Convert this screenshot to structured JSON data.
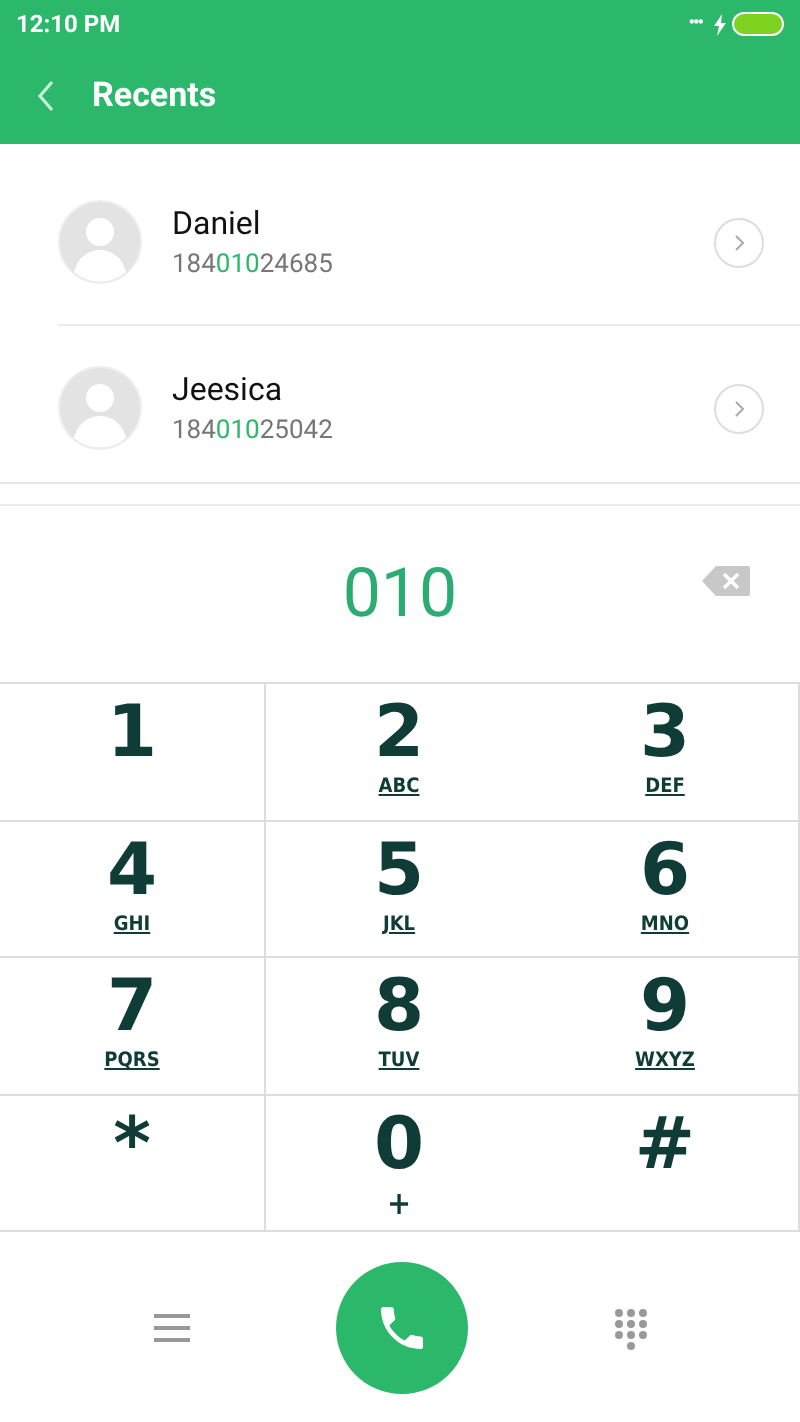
{
  "status_bar": {
    "time": "12:10 PM",
    "dots": "•••"
  },
  "header": {
    "title": "Recents"
  },
  "contacts": [
    {
      "name": "Daniel",
      "number": {
        "before": "184",
        "match": "010",
        "after": "24685"
      }
    },
    {
      "name": "Jeesica",
      "number": {
        "before": "184",
        "match": "010",
        "after": "25042"
      }
    }
  ],
  "dialed": "010",
  "keys": [
    {
      "digit": "1"
    },
    {
      "digit": "2",
      "letters": "ABC"
    },
    {
      "digit": "3",
      "letters": "DEF"
    },
    {
      "digit": "4",
      "letters": "GHI"
    },
    {
      "digit": "5",
      "letters": "JKL"
    },
    {
      "digit": "6",
      "letters": "MNO"
    },
    {
      "digit": "7",
      "letters": "PQRS"
    },
    {
      "digit": "8",
      "letters": "TUV"
    },
    {
      "digit": "9",
      "letters": "WXYZ"
    },
    {
      "digit": "*"
    },
    {
      "digit": "0",
      "letters": "+"
    },
    {
      "digit": "#"
    }
  ]
}
